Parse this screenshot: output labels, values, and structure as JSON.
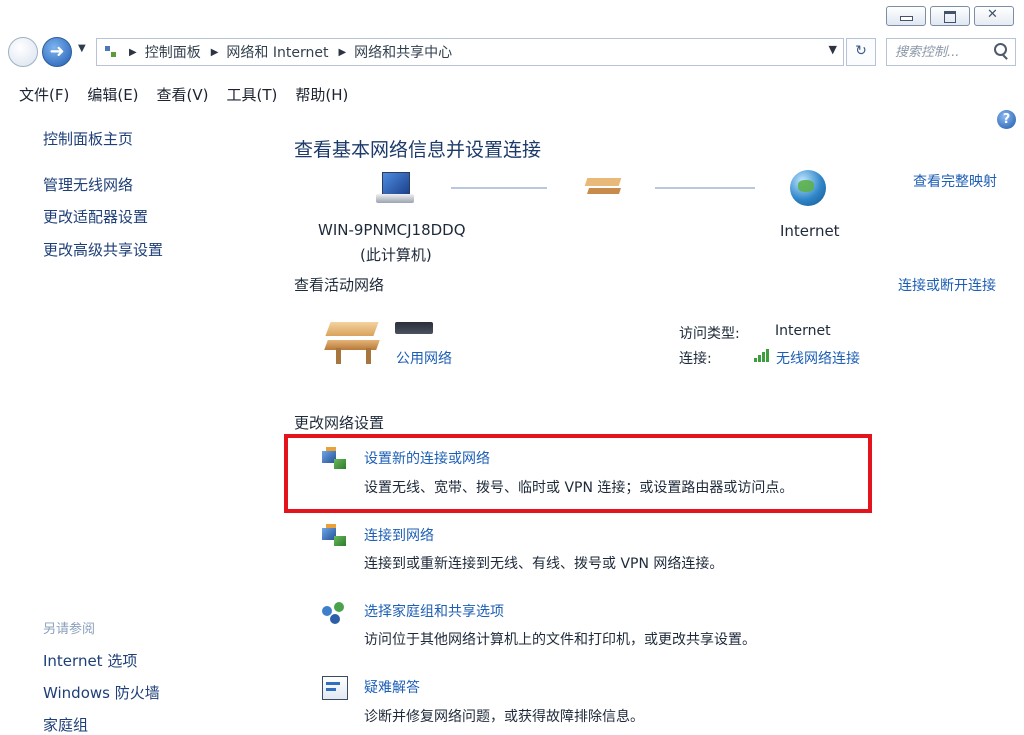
{
  "breadcrumb": [
    "控制面板",
    "网络和 Internet",
    "网络和共享中心"
  ],
  "search": {
    "placeholder": "搜索控制..."
  },
  "menu": [
    "文件(F)",
    "编辑(E)",
    "查看(V)",
    "工具(T)",
    "帮助(H)"
  ],
  "sidebar": {
    "home": "控制面板主页",
    "links": [
      "管理无线网络",
      "更改适配器设置",
      "更改高级共享设置"
    ],
    "see_also_heading": "另请参阅",
    "see_also": [
      "Internet 选项",
      "Windows 防火墙",
      "家庭组"
    ]
  },
  "main": {
    "title": "查看基本网络信息并设置连接",
    "full_map_link": "查看完整映射",
    "computer_name": "WIN-9PNMCJ18DDQ",
    "computer_sub": "(此计算机)",
    "internet_label": "Internet",
    "active_heading": "查看活动网络",
    "connect_disconnect_link": "连接或断开连接",
    "network_type": "公用网络",
    "access_type_label": "访问类型:",
    "access_type_value": "Internet",
    "connection_label": "连接:",
    "connection_value": "无线网络连接",
    "change_heading": "更改网络设置",
    "tasks": [
      {
        "title": "设置新的连接或网络",
        "desc": "设置无线、宽带、拨号、临时或 VPN 连接；或设置路由器或访问点。"
      },
      {
        "title": "连接到网络",
        "desc": "连接到或重新连接到无线、有线、拨号或 VPN 网络连接。"
      },
      {
        "title": "选择家庭组和共享选项",
        "desc": "访问位于其他网络计算机上的文件和打印机，或更改共享设置。"
      },
      {
        "title": "疑难解答",
        "desc": "诊断并修复网络问题，或获得故障排除信息。"
      }
    ]
  },
  "colors": {
    "highlight_border": "#e3141c",
    "link": "#1d5fb5"
  }
}
